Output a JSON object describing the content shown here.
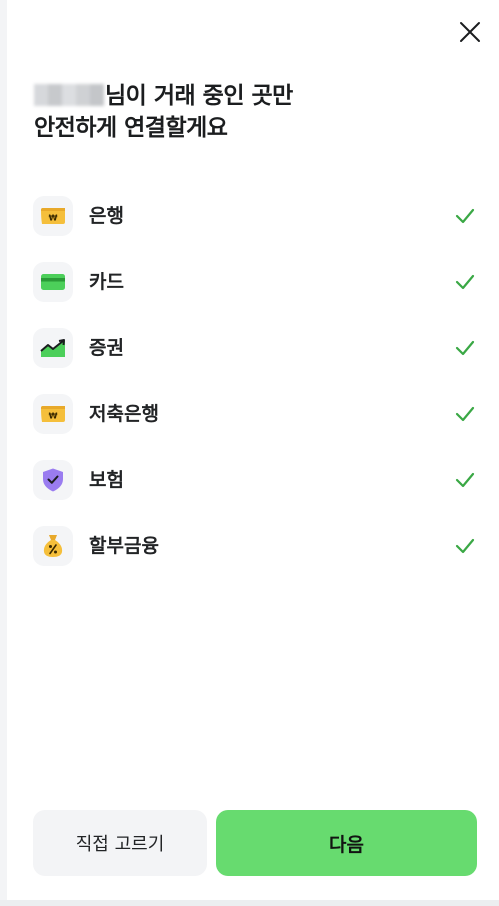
{
  "header": {
    "close_icon": "close-icon",
    "title_line1_suffix": "님이 거래 중인 곳만",
    "title_line2": "안전하게 연결할게요"
  },
  "categories": [
    {
      "label": "은행",
      "icon": "won-card-icon",
      "checked": true
    },
    {
      "label": "카드",
      "icon": "credit-card-icon",
      "checked": true
    },
    {
      "label": "증권",
      "icon": "stock-chart-icon",
      "checked": true
    },
    {
      "label": "저축은행",
      "icon": "won-card-icon",
      "checked": true
    },
    {
      "label": "보험",
      "icon": "shield-check-icon",
      "checked": true
    },
    {
      "label": "할부금융",
      "icon": "money-bag-percent-icon",
      "checked": true
    }
  ],
  "footer": {
    "secondary_label": "직접 고르기",
    "primary_label": "다음"
  },
  "colors": {
    "accent": "#67db6f",
    "check": "#3aa845",
    "secondary_bg": "#f3f4f6"
  }
}
